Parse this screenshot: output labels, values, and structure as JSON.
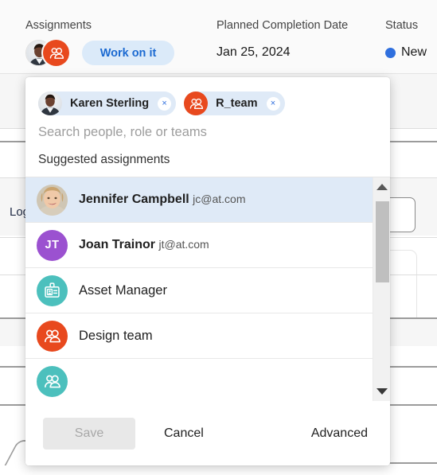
{
  "header": {
    "columns": [
      {
        "label": "Assignments",
        "value": ""
      },
      {
        "label": "Planned Completion Date",
        "value": "Jan 25, 2024"
      },
      {
        "label": "Status",
        "value": "New"
      }
    ],
    "assignments_label": "Assignments",
    "planned_label": "Planned Completion Date",
    "planned_value": "Jan 25, 2024",
    "status_label": "Status",
    "status_value": "New",
    "status_color": "#2f6fde",
    "work_button": "Work on it"
  },
  "background": {
    "log_label": "Log"
  },
  "panel": {
    "chips": [
      {
        "label": "Karen Sterling",
        "type": "person",
        "remove": "×"
      },
      {
        "label": "R_team",
        "type": "team",
        "remove": "×"
      }
    ],
    "search": {
      "value": "",
      "placeholder": "Search people, role or teams"
    },
    "list_heading": "Suggested assignments",
    "suggestions": [
      {
        "name": "Jennifer Campbell",
        "email": "jc@at.com",
        "avatar_type": "photo-female",
        "avatar_color": "#c9a27a",
        "selected": true
      },
      {
        "name": "Joan Trainor",
        "email": "jt@at.com",
        "avatar_type": "initials",
        "initials": "JT",
        "avatar_color": "#9b51d0",
        "selected": false
      },
      {
        "name": "Asset Manager",
        "email": "",
        "avatar_type": "badge-icon",
        "avatar_color": "#4cc0bd",
        "selected": false
      },
      {
        "name": "Design team",
        "email": "",
        "avatar_type": "team-icon",
        "avatar_color": "#e8491e",
        "selected": false
      },
      {
        "name": "",
        "email": "",
        "avatar_type": "team-icon",
        "avatar_color": "#4cc0bd",
        "selected": false
      }
    ],
    "scrollbar": {
      "up_arrow": "▲",
      "down_arrow": "▼"
    },
    "footer": {
      "save": "Save",
      "cancel": "Cancel",
      "advanced": "Advanced"
    }
  }
}
